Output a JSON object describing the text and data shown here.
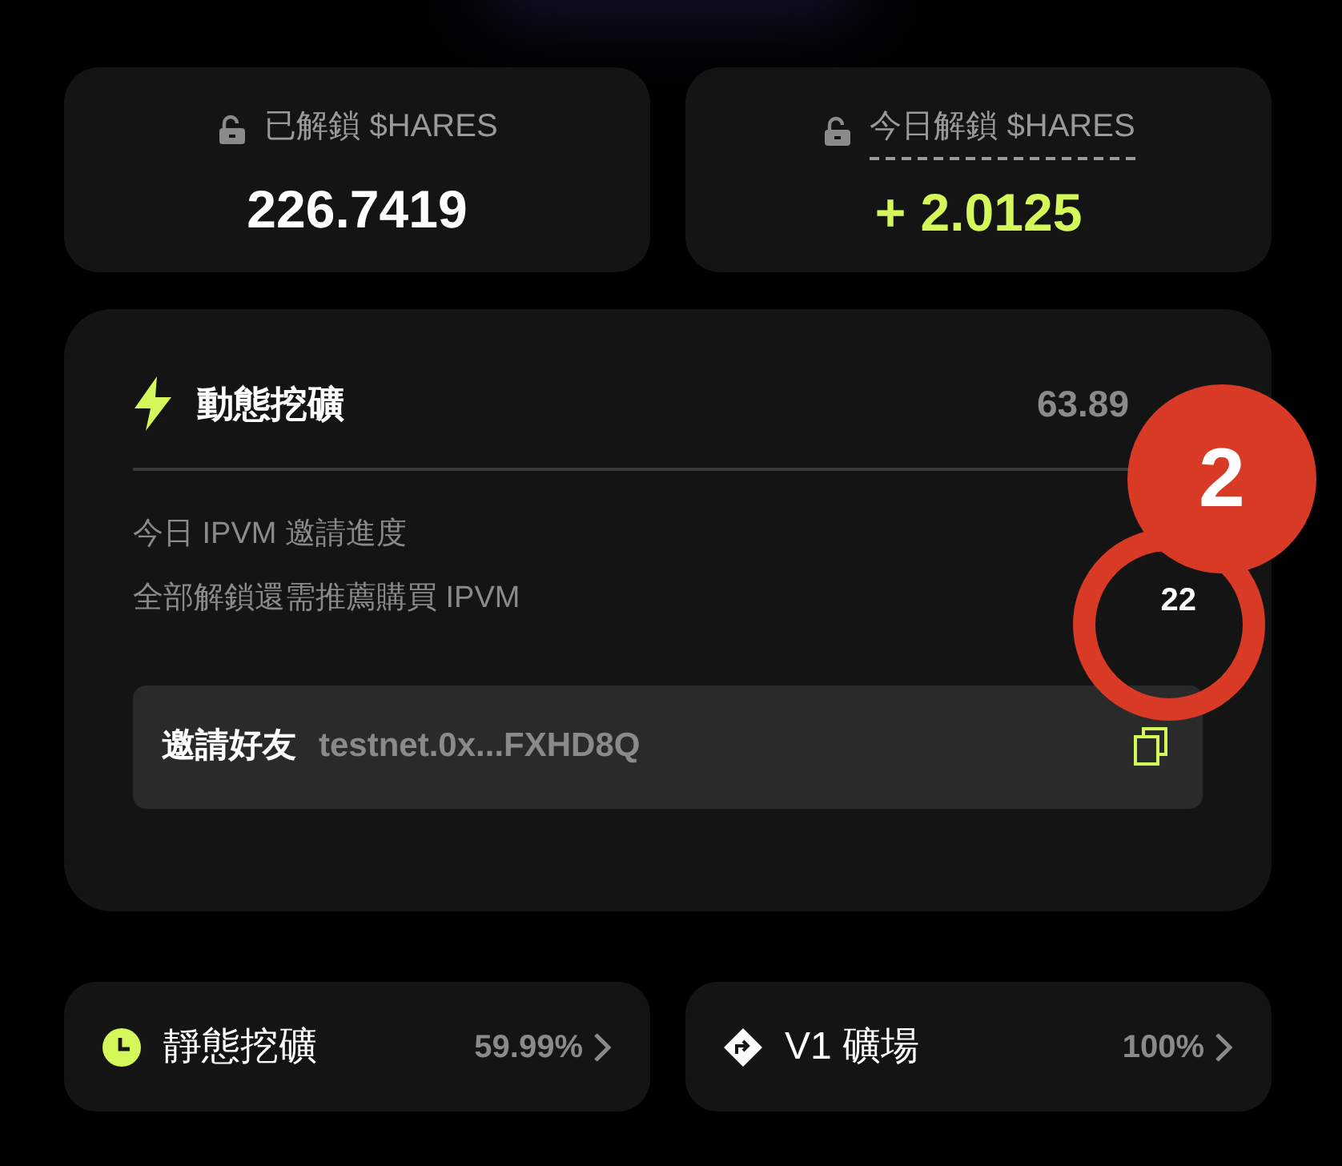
{
  "stats": [
    {
      "label": "已解鎖 $HARES",
      "value": "226.7419",
      "highlight": false,
      "underlined": false
    },
    {
      "label": "今日解鎖 $HARES",
      "value": "+ 2.0125",
      "highlight": true,
      "underlined": true
    }
  ],
  "dynamic_mining": {
    "title": "動態挖礦",
    "percent": "63.89",
    "rows": [
      {
        "label": "今日 IPVM 邀請進度"
      },
      {
        "label": "全部解鎖還需推薦購買 IPVM",
        "value": "22"
      }
    ],
    "invite": {
      "label": "邀請好友",
      "address": "testnet.0x...FXHD8Q"
    }
  },
  "links": [
    {
      "kind": "clock",
      "label": "靜態挖礦",
      "percent": "59.99%"
    },
    {
      "kind": "route",
      "label": "V1 礦場",
      "percent": "100%"
    }
  ],
  "annotation": {
    "badge": "2"
  }
}
